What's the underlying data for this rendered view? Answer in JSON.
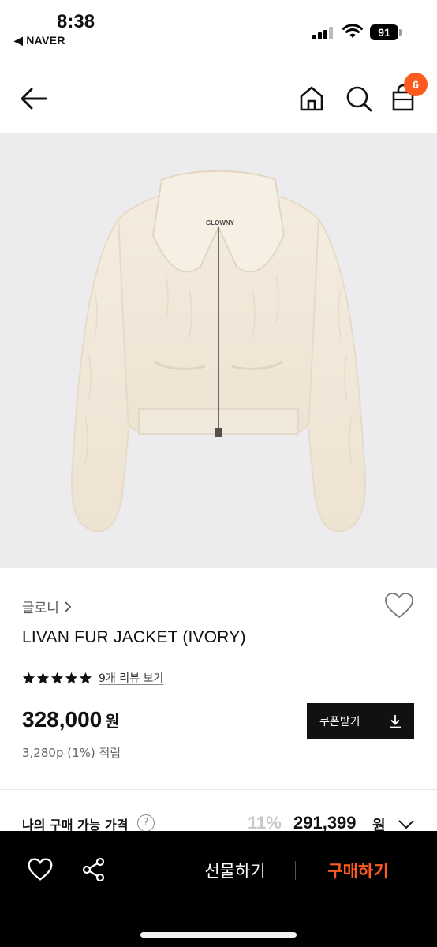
{
  "status_bar": {
    "time": "8:38",
    "back_app": "◀ NAVER",
    "battery": "91"
  },
  "nav": {
    "cart_count": "6",
    "accent_color": "#ff5a1f"
  },
  "product": {
    "image_label": "GLOWNY",
    "brand": "글로니",
    "name": "LIVAN FUR JACKET (IVORY)",
    "rating_stars": 5,
    "review_link": "9개 리뷰 보기",
    "price": "328,000",
    "currency": "원",
    "points": "3,280p (1%) 적립",
    "coupon_label": "쿠폰받기"
  },
  "my_price": {
    "label": "나의 구매 가능 가격",
    "help": "?",
    "discount": "11%",
    "price": "291,399",
    "currency": "원"
  },
  "bottom_bar": {
    "gift_label": "선물하기",
    "buy_label": "구매하기"
  }
}
